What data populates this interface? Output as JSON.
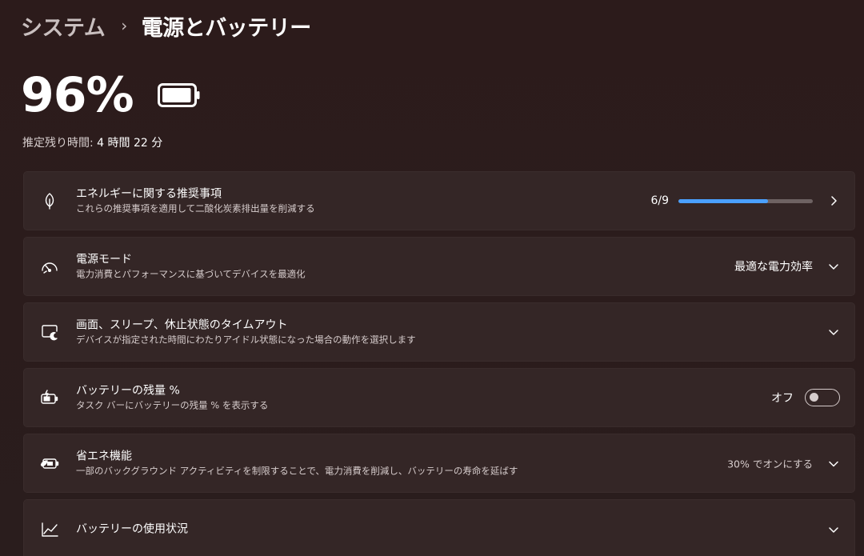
{
  "breadcrumb": {
    "parent": "システム",
    "separator": "›",
    "current": "電源とバッテリー"
  },
  "battery": {
    "percent_label": "96%",
    "level": 0.96,
    "remaining_label": "推定残り時間:",
    "remaining_value": "4 時間 22 分"
  },
  "cards": {
    "energy": {
      "title": "エネルギーに関する推奨事項",
      "desc": "これらの推奨事項を適用して二酸化炭素排出量を削減する",
      "progress_label": "6/9",
      "progress": 0.667,
      "icon": "leaf-icon"
    },
    "power_mode": {
      "title": "電源モード",
      "desc": "電力消費とパフォーマンスに基づいてデバイスを最適化",
      "value": "最適な電力効率",
      "icon": "gauge-icon"
    },
    "screen_sleep": {
      "title": "画面、スリープ、休止状態のタイムアウト",
      "desc": "デバイスが指定された時間にわたりアイドル状態になった場合の動作を選択します",
      "icon": "screen-sleep-icon"
    },
    "battery_percent": {
      "title": "バッテリーの残量 %",
      "desc": "タスク バーにバッテリーの残量 % を表示する",
      "toggle_label": "オフ",
      "toggle_on": false,
      "icon": "battery-charging-icon"
    },
    "energy_saver": {
      "title": "省エネ機能",
      "desc": "一部のバックグラウンド アクティビティを制限することで、電力消費を削減し、バッテリーの寿命を延ばす",
      "value": "30% でオンにする",
      "icon": "battery-saver-icon"
    },
    "battery_usage": {
      "title": "バッテリーの使用状況",
      "icon": "chart-icon"
    }
  },
  "colors": {
    "accent": "#4aa0ff",
    "card_bg": "#342626",
    "page_bg": "#2b1c1c"
  }
}
